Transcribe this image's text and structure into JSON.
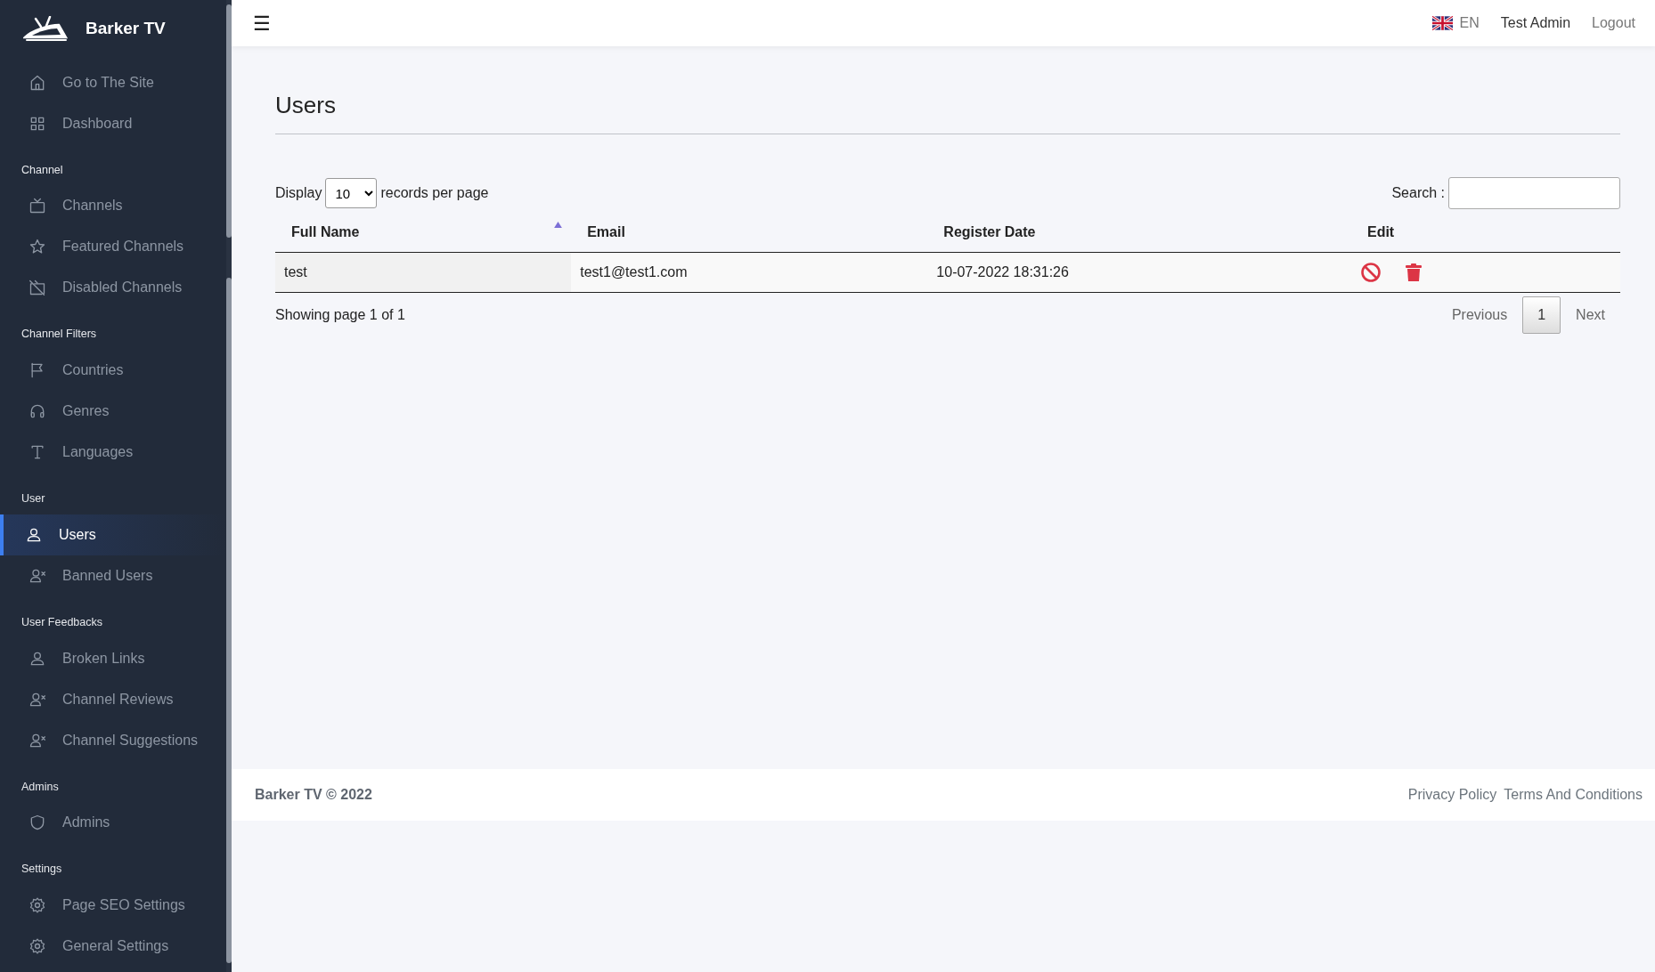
{
  "brand": {
    "title": "Barker TV"
  },
  "sidebar": {
    "sections": [
      {
        "items": [
          {
            "label": "Go to The Site",
            "kind": "home",
            "selected": false
          },
          {
            "label": "Dashboard",
            "kind": "grid",
            "selected": false
          }
        ]
      },
      {
        "heading": "Channel",
        "items": [
          {
            "label": "Channels",
            "kind": "tv",
            "selected": false
          },
          {
            "label": "Featured Channels",
            "kind": "star",
            "selected": false
          },
          {
            "label": "Disabled Channels",
            "kind": "tvoff",
            "selected": false
          }
        ]
      },
      {
        "heading": "Channel Filters",
        "items": [
          {
            "label": "Countries",
            "kind": "flag",
            "selected": false
          },
          {
            "label": "Genres",
            "kind": "headphones",
            "selected": false
          },
          {
            "label": "Languages",
            "kind": "type",
            "selected": false
          }
        ]
      },
      {
        "heading": "User",
        "items": [
          {
            "label": "Users",
            "kind": "user",
            "selected": true
          },
          {
            "label": "Banned Users",
            "kind": "userx",
            "selected": false
          }
        ]
      },
      {
        "heading": "User Feedbacks",
        "items": [
          {
            "label": "Broken Links",
            "kind": "user",
            "selected": false
          },
          {
            "label": "Channel Reviews",
            "kind": "userx",
            "selected": false
          },
          {
            "label": "Channel Suggestions",
            "kind": "userx",
            "selected": false
          }
        ]
      },
      {
        "heading": "Admins",
        "items": [
          {
            "label": "Admins",
            "kind": "shield",
            "selected": false
          }
        ]
      },
      {
        "heading": "Settings",
        "items": [
          {
            "label": "Page SEO Settings",
            "kind": "gear",
            "selected": false
          },
          {
            "label": "General Settings",
            "kind": "gear",
            "selected": false
          }
        ]
      }
    ]
  },
  "topbar": {
    "menu_glyph": "☰",
    "language": "EN",
    "user": "Test Admin",
    "logout": "Logout"
  },
  "page": {
    "title": "Users",
    "length": {
      "before": "Display",
      "value": "10",
      "after": "records per page"
    },
    "search": {
      "label": "Search :"
    },
    "table": {
      "columns": [
        {
          "label": "Full Name",
          "sorted": true
        },
        {
          "label": "Email",
          "sorted": false
        },
        {
          "label": "Register Date",
          "sorted": false
        },
        {
          "label": "Edit",
          "sorted": false
        }
      ],
      "rows": [
        {
          "cells": [
            "test",
            "test1@test1.com",
            "10-07-2022 18:31:26"
          ],
          "actions": [
            {
              "kind": "ban"
            },
            {
              "kind": "delete"
            }
          ]
        }
      ]
    },
    "info": "Showing page 1 of 1",
    "pagination": [
      {
        "label": "Previous",
        "selected": false
      },
      {
        "label": "1",
        "selected": true
      },
      {
        "label": "Next",
        "selected": false
      }
    ]
  },
  "footer": {
    "copyright": "Barker TV © 2022",
    "links": [
      "Privacy Policy",
      "Terms And Conditions"
    ]
  }
}
